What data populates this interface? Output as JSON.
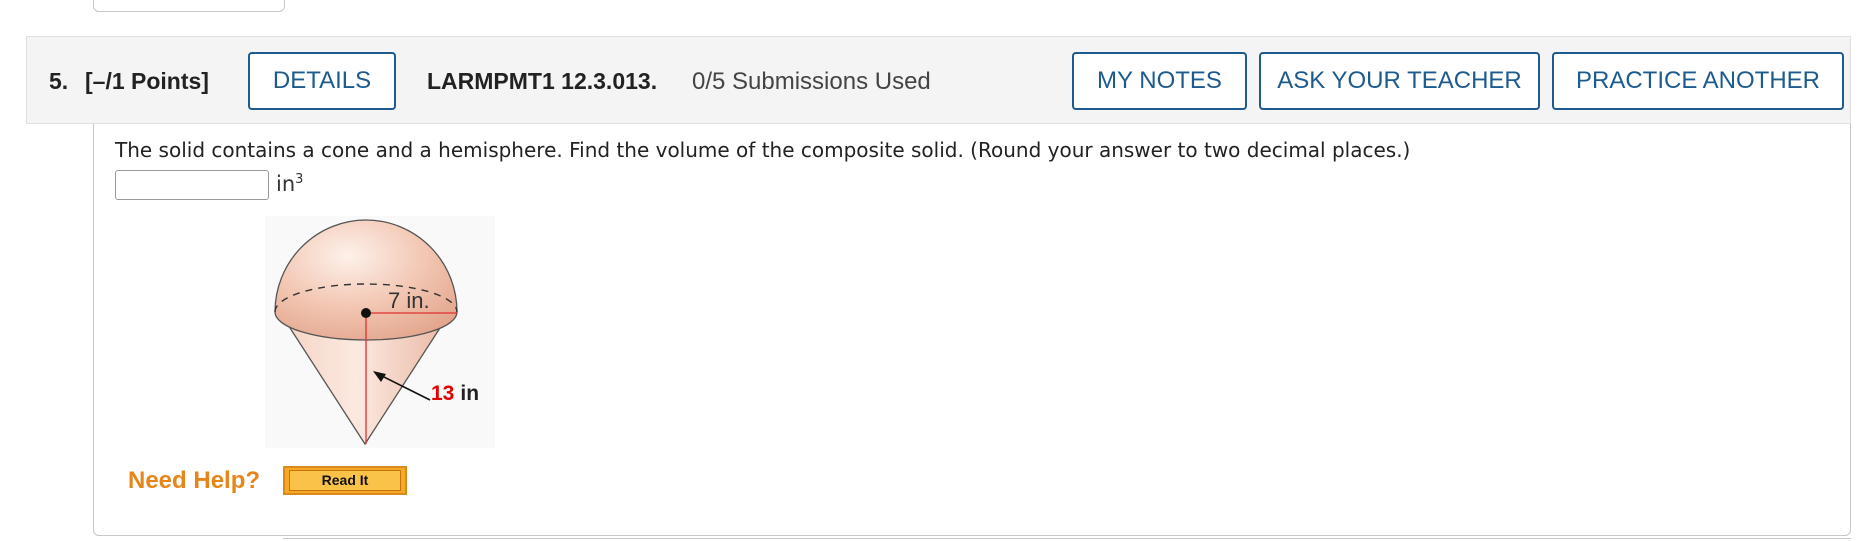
{
  "question": {
    "number": "5.",
    "points": "[–/1 Points]",
    "details_label": "DETAILS",
    "code": "LARMPMT1 12.3.013.",
    "submissions": "0/5 Submissions Used",
    "my_notes_label": "MY NOTES",
    "ask_teacher_label": "ASK YOUR TEACHER",
    "practice_label": "PRACTICE ANOTHER"
  },
  "body": {
    "prompt": "The solid contains a cone and a hemisphere. Find the volume of the composite solid. (Round your answer to two decimal places.)",
    "answer_value": "",
    "unit": "in",
    "unit_exponent": "3"
  },
  "figure": {
    "radius_label": "7 in.",
    "slant_value": "13",
    "slant_unit": "in",
    "slant_color": "#e00000"
  },
  "help": {
    "need_help_label": "Need Help?",
    "read_it_label": "Read It"
  }
}
